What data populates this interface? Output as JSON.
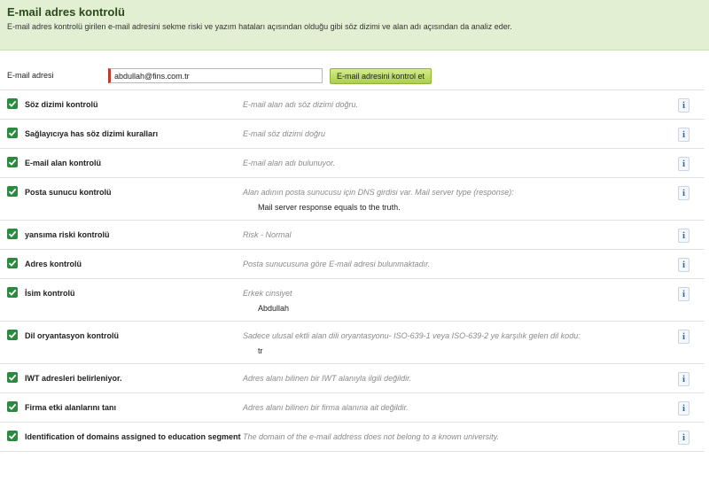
{
  "header": {
    "title": "E-mail adres kontrolü",
    "description": "E-mail adres kontrolü girilen e-mail adresini sekme riski ve yazım hataları açısından olduğu gibi söz dizimi ve alan adı açısından da analiz eder."
  },
  "form": {
    "label": "E-mail adresi",
    "email_value": "abdullah@fins.com.tr",
    "button_label": "E-mail adresini kontrol et"
  },
  "info_icon_char": "i",
  "checks": [
    {
      "label": "Söz dizimi kontrolü",
      "result": "E-mail alan adı söz dizimi doğru.",
      "extra": "",
      "status": "passed"
    },
    {
      "label": "Sağlayıcıya has söz dizimi kuralları",
      "result": "E-mail söz dizimi doğru",
      "extra": "",
      "status": "passed"
    },
    {
      "label": "E-mail alan kontrolü",
      "result": "E-mail alan adı bulunuyor.",
      "extra": "",
      "status": "passed"
    },
    {
      "label": "Posta sunucu kontrolü",
      "result": "Alan adının posta sunucusu için DNS girdisi var. Mail server type (response):",
      "extra": "Mail server response equals to the truth.",
      "status": "passed"
    },
    {
      "label": "yansıma riski kontrolü",
      "result": "Risk - Normal",
      "extra": "",
      "status": "passed"
    },
    {
      "label": "Adres kontrolü",
      "result": "Posta sunucusuna göre E-mail adresi bulunmaktadır.",
      "extra": "",
      "status": "passed"
    },
    {
      "label": "İsim kontrolü",
      "result": "Erkek cinsiyet",
      "extra": "Abdullah",
      "status": "passed"
    },
    {
      "label": "Dil oryantasyon kontrolü",
      "result": "Sadece ulusal ektli alan dili oryantasyonu- ISO-639-1 veya ISO-639-2 ye karşılık gelen dil kodu:",
      "extra": "tr",
      "status": "passed"
    },
    {
      "label": "IWT adresleri belirleniyor.",
      "result": "Adres alanı bilinen bir IWT alanıyla ilgili değildir.",
      "extra": "",
      "status": "passed"
    },
    {
      "label": "Firma etki alanlarını tanı",
      "result": "Adres alanı bilinen bir firma alanına ait değildir.",
      "extra": "",
      "status": "passed"
    },
    {
      "label": "Identification of domains assigned to education segment",
      "result": "The domain of the e-mail address does not belong to a known university.",
      "extra": "",
      "status": "passed"
    }
  ],
  "colors": {
    "header_bg": "#e3efd3",
    "check_green": "#2b8a3e",
    "button_green": "#a9cf4a",
    "input_accent": "#c0392b",
    "info_blue": "#1f6fb5"
  }
}
